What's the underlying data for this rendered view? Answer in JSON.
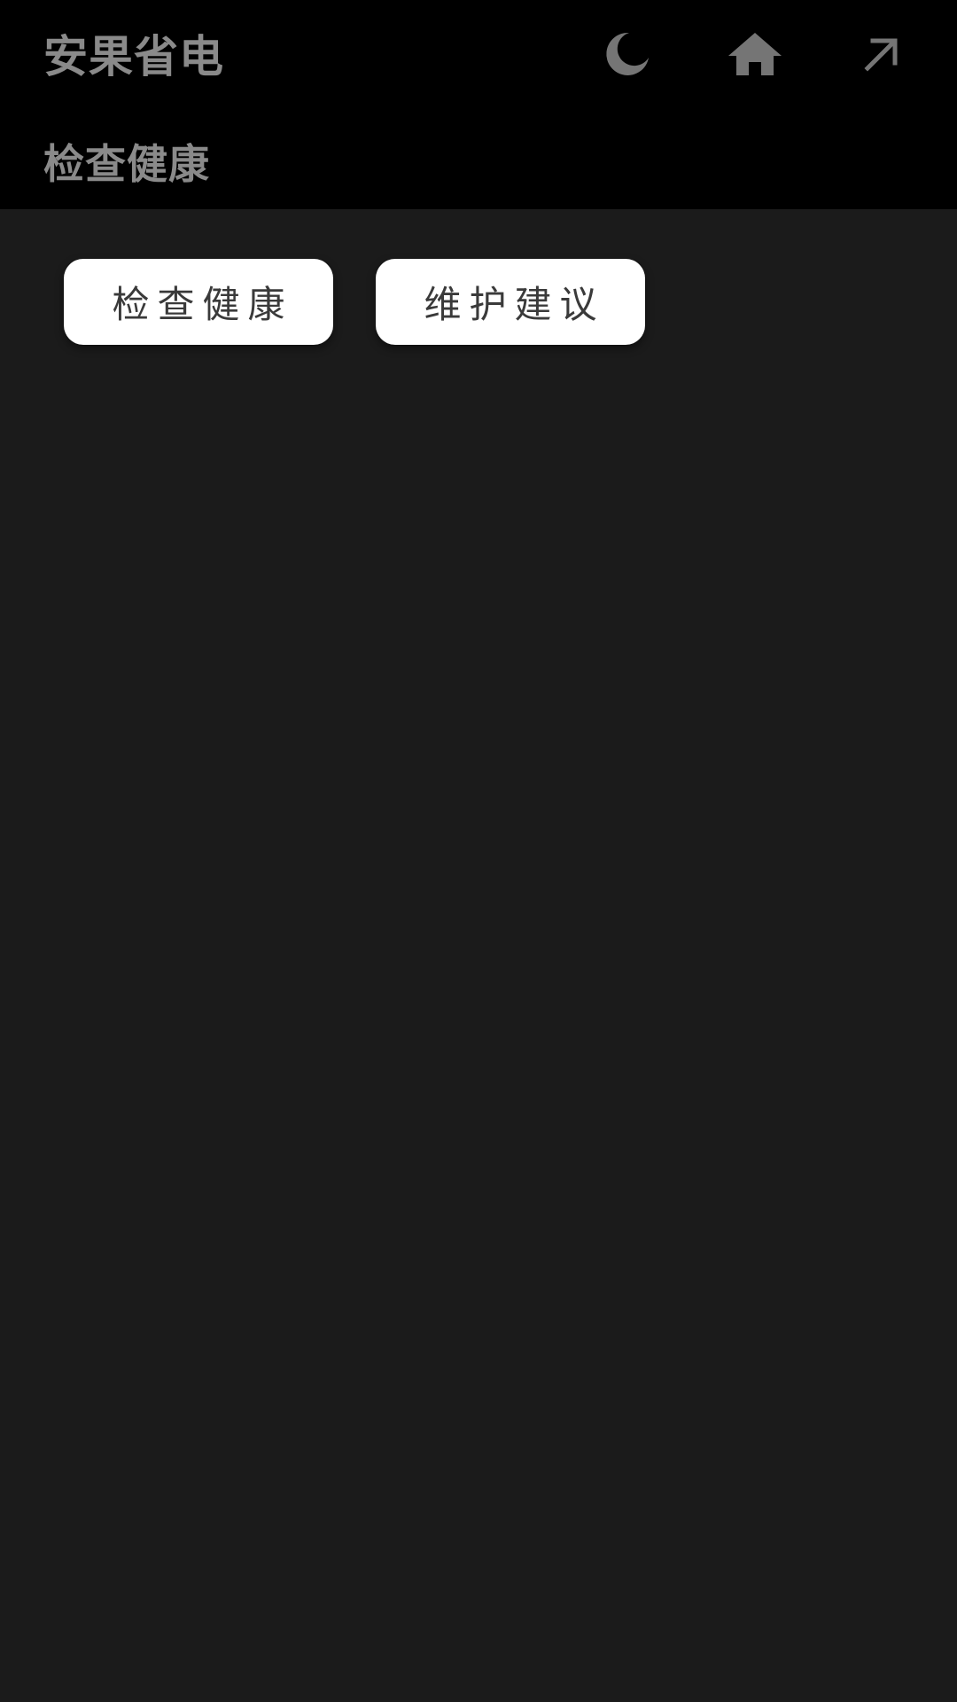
{
  "header": {
    "app_title": "安果省电",
    "page_title": "检查健康",
    "icons": {
      "night_mode": "moon-icon",
      "home": "home-icon",
      "open_external": "arrow-up-right-icon"
    },
    "icon_color": "#757575",
    "text_color": "#8a8a8a",
    "background": "#000000"
  },
  "main": {
    "background": "#1b1b1b",
    "buttons": [
      {
        "label": "检查健康"
      },
      {
        "label": "维护建议"
      }
    ],
    "button_background": "#ffffff",
    "button_text_color": "#3a3a3a"
  }
}
